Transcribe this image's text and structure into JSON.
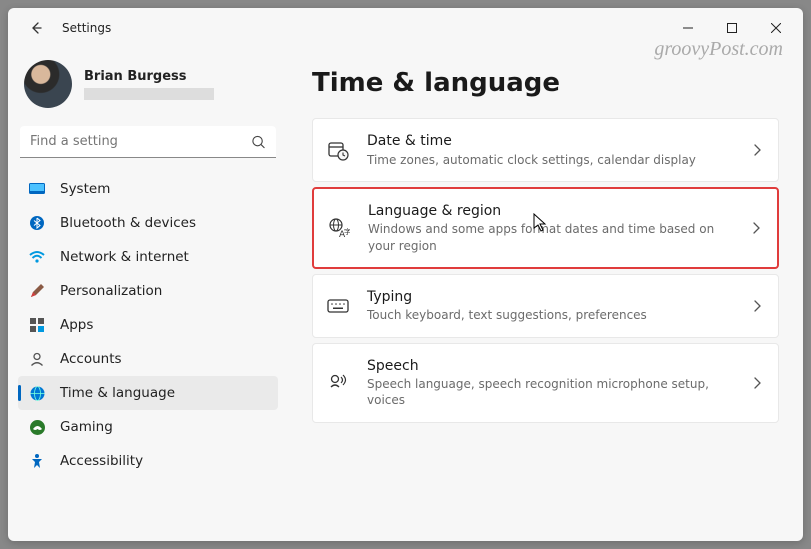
{
  "window": {
    "title": "Settings"
  },
  "watermark": "groovyPost.com",
  "profile": {
    "name": "Brian Burgess"
  },
  "search": {
    "placeholder": "Find a setting"
  },
  "nav": {
    "items": [
      {
        "label": "System"
      },
      {
        "label": "Bluetooth & devices"
      },
      {
        "label": "Network & internet"
      },
      {
        "label": "Personalization"
      },
      {
        "label": "Apps"
      },
      {
        "label": "Accounts"
      },
      {
        "label": "Time & language"
      },
      {
        "label": "Gaming"
      },
      {
        "label": "Accessibility"
      }
    ]
  },
  "page": {
    "title": "Time & language"
  },
  "cards": [
    {
      "title": "Date & time",
      "sub": "Time zones, automatic clock settings, calendar display"
    },
    {
      "title": "Language & region",
      "sub": "Windows and some apps format dates and time based on your region"
    },
    {
      "title": "Typing",
      "sub": "Touch keyboard, text suggestions, preferences"
    },
    {
      "title": "Speech",
      "sub": "Speech language, speech recognition microphone setup, voices"
    }
  ]
}
